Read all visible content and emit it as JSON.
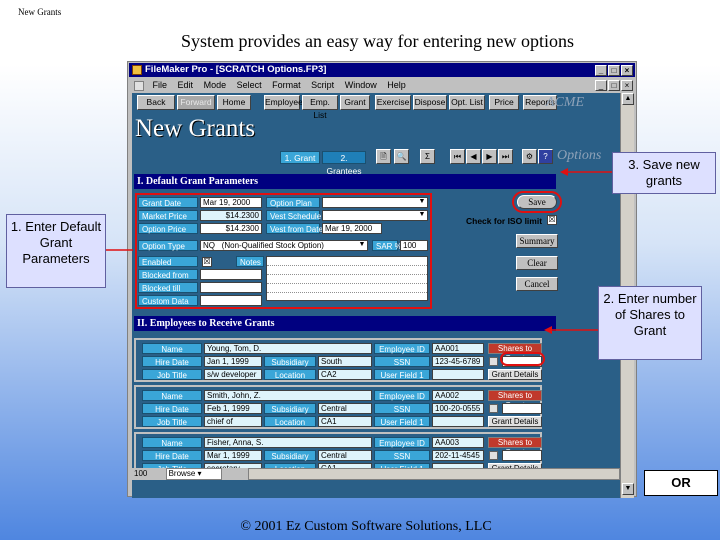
{
  "slide": {
    "corner_label": "New Grants",
    "title": "System provides an easy way for entering new options",
    "footer": "© 2001 Ez Custom Software Solutions, LLC"
  },
  "window": {
    "title": "FileMaker Pro - [SCRATCH Options.FP3]",
    "menu": [
      "File",
      "Edit",
      "Mode",
      "Select",
      "Format",
      "Script",
      "Window",
      "Help"
    ],
    "nav_buttons": [
      "Back",
      "Forward",
      "Home",
      "Employee",
      "Emp. List",
      "Grant",
      "Exercise",
      "Dispose",
      "Opt. List",
      "Price",
      "Reports"
    ],
    "brand": "ACME",
    "status_zoom": "100",
    "status_mode": "Browse"
  },
  "layout": {
    "title": "New Grants",
    "tabs": [
      "1. Grant",
      "2. Grantees"
    ],
    "options_label": "Options"
  },
  "section1": {
    "header": "I. Default Grant Parameters",
    "grant_date_label": "Grant Date",
    "grant_date": "Mar 19, 2000",
    "market_price_label": "Market Price",
    "market_price": "$14.2300",
    "option_price_label": "Option Price",
    "option_price": "$14.2300",
    "option_plan_label": "Option Plan",
    "option_plan": "",
    "vest_schedule_label": "Vest Schedule",
    "vest_schedule": "",
    "vest_from_label": "Vest from Date",
    "vest_from": "Mar 19, 2000",
    "option_type_label": "Option Type",
    "option_type_code": "NQ",
    "option_type_desc": "(Non-Qualified Stock Option)",
    "sar_label": "SAR %",
    "sar": "100",
    "enabled_label": "Enabled",
    "enabled_check": "☒",
    "notes_label": "Notes",
    "blocked_from_label": "Blocked from",
    "blocked_from": "",
    "blocked_till_label": "Blocked till",
    "blocked_till": "",
    "custom_data_label": "Custom Data",
    "custom_data": "",
    "buttons": {
      "save": "Save",
      "summary": "Summary",
      "clear": "Clear",
      "cancel": "Cancel"
    },
    "iso_label": "Check for ISO limit",
    "iso_check": "☒"
  },
  "section2": {
    "header": "II. Employees to Receive Grants",
    "labels": {
      "name": "Name",
      "hire_date": "Hire Date",
      "job_title": "Job Title",
      "employee_id": "Employee ID",
      "ssn": "SSN",
      "user_field": "User Field 1",
      "subsidiary": "Subsidiary",
      "location": "Location",
      "shares": "Shares to Grant",
      "grant_details": "Grant Details"
    },
    "employees": [
      {
        "name": "Young, Tom, D.",
        "hire_date": "Jan 1, 1999",
        "job_title": "s/w developer",
        "subsidiary": "South",
        "location": "CA2",
        "employee_id": "AA001",
        "ssn": "123-45-6789",
        "user_field": "",
        "shares": ""
      },
      {
        "name": "Smith, John, Z.",
        "hire_date": "Feb 1, 1999",
        "job_title": "chief of",
        "subsidiary": "Central",
        "location": "CA1",
        "employee_id": "AA002",
        "ssn": "100-20-0555",
        "user_field": "",
        "shares": ""
      },
      {
        "name": "Fisher, Anna, S.",
        "hire_date": "Mar 1, 1999",
        "job_title": "secretary",
        "subsidiary": "Central",
        "location": "CA1",
        "employee_id": "AA003",
        "ssn": "202-11-4545",
        "user_field": "",
        "shares": ""
      }
    ]
  },
  "callouts": {
    "c1": "1. Enter Default Grant Parameters",
    "c2": "2. Enter number of Shares to Grant",
    "c3": "3. Save new grants",
    "or": "OR"
  },
  "colors": {
    "field_label_bg": "#3aa6d8",
    "section_bar": "#000080",
    "highlight": "#e01010",
    "shares_label": "#c0392b",
    "callout_bg": "#dde0ff"
  }
}
